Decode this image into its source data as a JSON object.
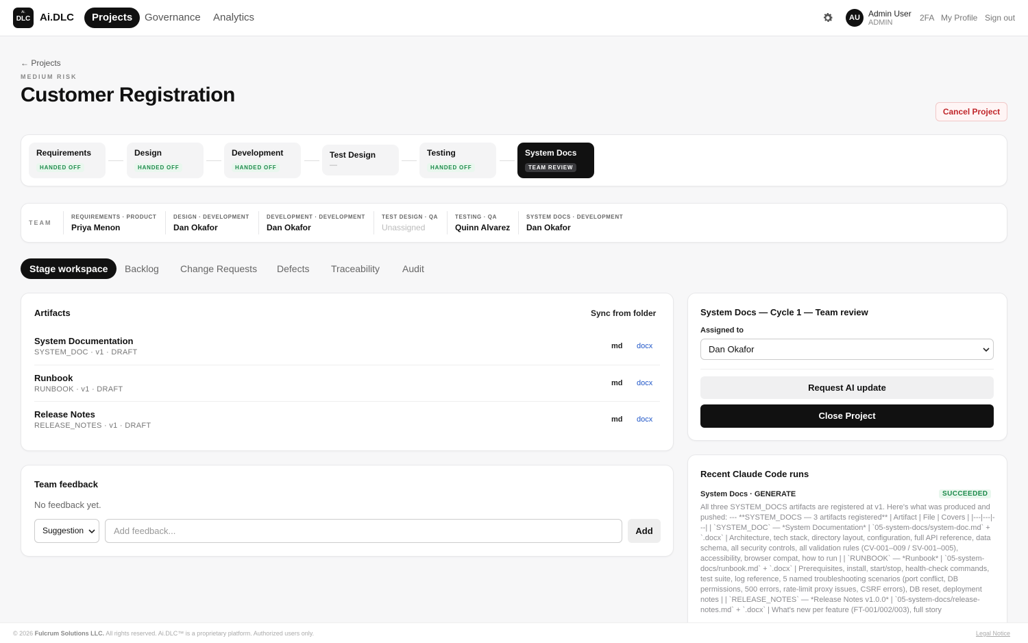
{
  "app": {
    "logo_top": "Ai.",
    "logo_bottom": "DLC",
    "name": "Ai.DLC"
  },
  "nav": {
    "items": [
      "Projects",
      "Governance",
      "Analytics"
    ],
    "active": "Projects"
  },
  "user": {
    "initials": "AU",
    "name": "Admin User",
    "role": "ADMIN",
    "links": [
      "2FA",
      "My Profile",
      "Sign out"
    ]
  },
  "header": {
    "back": "← Projects",
    "risk": "MEDIUM RISK",
    "title": "Customer Registration",
    "cancel": "Cancel Project"
  },
  "stages": [
    {
      "name": "Requirements",
      "status": "HANDED OFF"
    },
    {
      "name": "Design",
      "status": "HANDED OFF"
    },
    {
      "name": "Development",
      "status": "HANDED OFF"
    },
    {
      "name": "Test Design",
      "status": "—"
    },
    {
      "name": "Testing",
      "status": "HANDED OFF"
    },
    {
      "name": "System Docs",
      "status": "TEAM REVIEW"
    }
  ],
  "team": {
    "label": "TEAM",
    "members": [
      {
        "role": "REQUIREMENTS · PRODUCT",
        "name": "Priya Menon"
      },
      {
        "role": "DESIGN · DEVELOPMENT",
        "name": "Dan Okafor"
      },
      {
        "role": "DEVELOPMENT · DEVELOPMENT",
        "name": "Dan Okafor"
      },
      {
        "role": "TEST DESIGN · QA",
        "name": "Unassigned"
      },
      {
        "role": "TESTING · QA",
        "name": "Quinn Alvarez"
      },
      {
        "role": "SYSTEM DOCS · DEVELOPMENT",
        "name": "Dan Okafor"
      }
    ]
  },
  "tabs": [
    "Stage workspace",
    "Backlog",
    "Change Requests",
    "Defects",
    "Traceability",
    "Audit"
  ],
  "artifacts": {
    "title": "Artifacts",
    "sync": "Sync from folder",
    "items": [
      {
        "name": "System Documentation",
        "meta": "SYSTEM_DOC · v1 · DRAFT",
        "md": "md",
        "docx": "docx"
      },
      {
        "name": "Runbook",
        "meta": "RUNBOOK · v1 · DRAFT",
        "md": "md",
        "docx": "docx"
      },
      {
        "name": "Release Notes",
        "meta": "RELEASE_NOTES · v1 · DRAFT",
        "md": "md",
        "docx": "docx"
      }
    ]
  },
  "feedback": {
    "title": "Team feedback",
    "empty": "No feedback yet.",
    "type": "Suggestion",
    "placeholder": "Add feedback...",
    "add": "Add"
  },
  "cycle": {
    "title": "System Docs — Cycle 1 — Team review",
    "assigned_label": "Assigned to",
    "assigned_value": "Dan Okafor",
    "request_ai": "Request AI update",
    "close": "Close Project"
  },
  "runs": {
    "title": "Recent Claude Code runs",
    "head": "System Docs · GENERATE",
    "status": "SUCCEEDED",
    "log": "All three SYSTEM_DOCS artifacts are registered at v1. Here's what was produced and pushed: --- **SYSTEM_DOCS — 3 artifacts registered** | Artifact | File | Covers | |---|---|---| | `SYSTEM_DOC` — *System Documentation* | `05-system-docs/system-doc.md` + `.docx` | Architecture, tech stack, directory layout, configuration, full API reference, data schema, all security controls, all validation rules (CV-001–009 / SV-001–005), accessibility, browser compat, how to run | | `RUNBOOK` — *Runbook* | `05-system-docs/runbook.md` + `.docx` | Prerequisites, install, start/stop, health-check commands, test suite, log reference, 5 named troubleshooting scenarios (port conflict, DB permissions, 500 errors, rate-limit proxy issues, CSRF errors), DB reset, deployment notes | | `RELEASE_NOTES` — *Release Notes v1.0.0* | `05-system-docs/release-notes.md` + `.docx` | What's new per feature (FT-001/002/003), full story"
  },
  "footer": {
    "copy_pre": "© 2026",
    "company": "Fulcrum Solutions LLC.",
    "copy_post": "All rights reserved. Ai.DLC™ is a proprietary platform. Authorized users only.",
    "legal": "Legal Notice"
  }
}
